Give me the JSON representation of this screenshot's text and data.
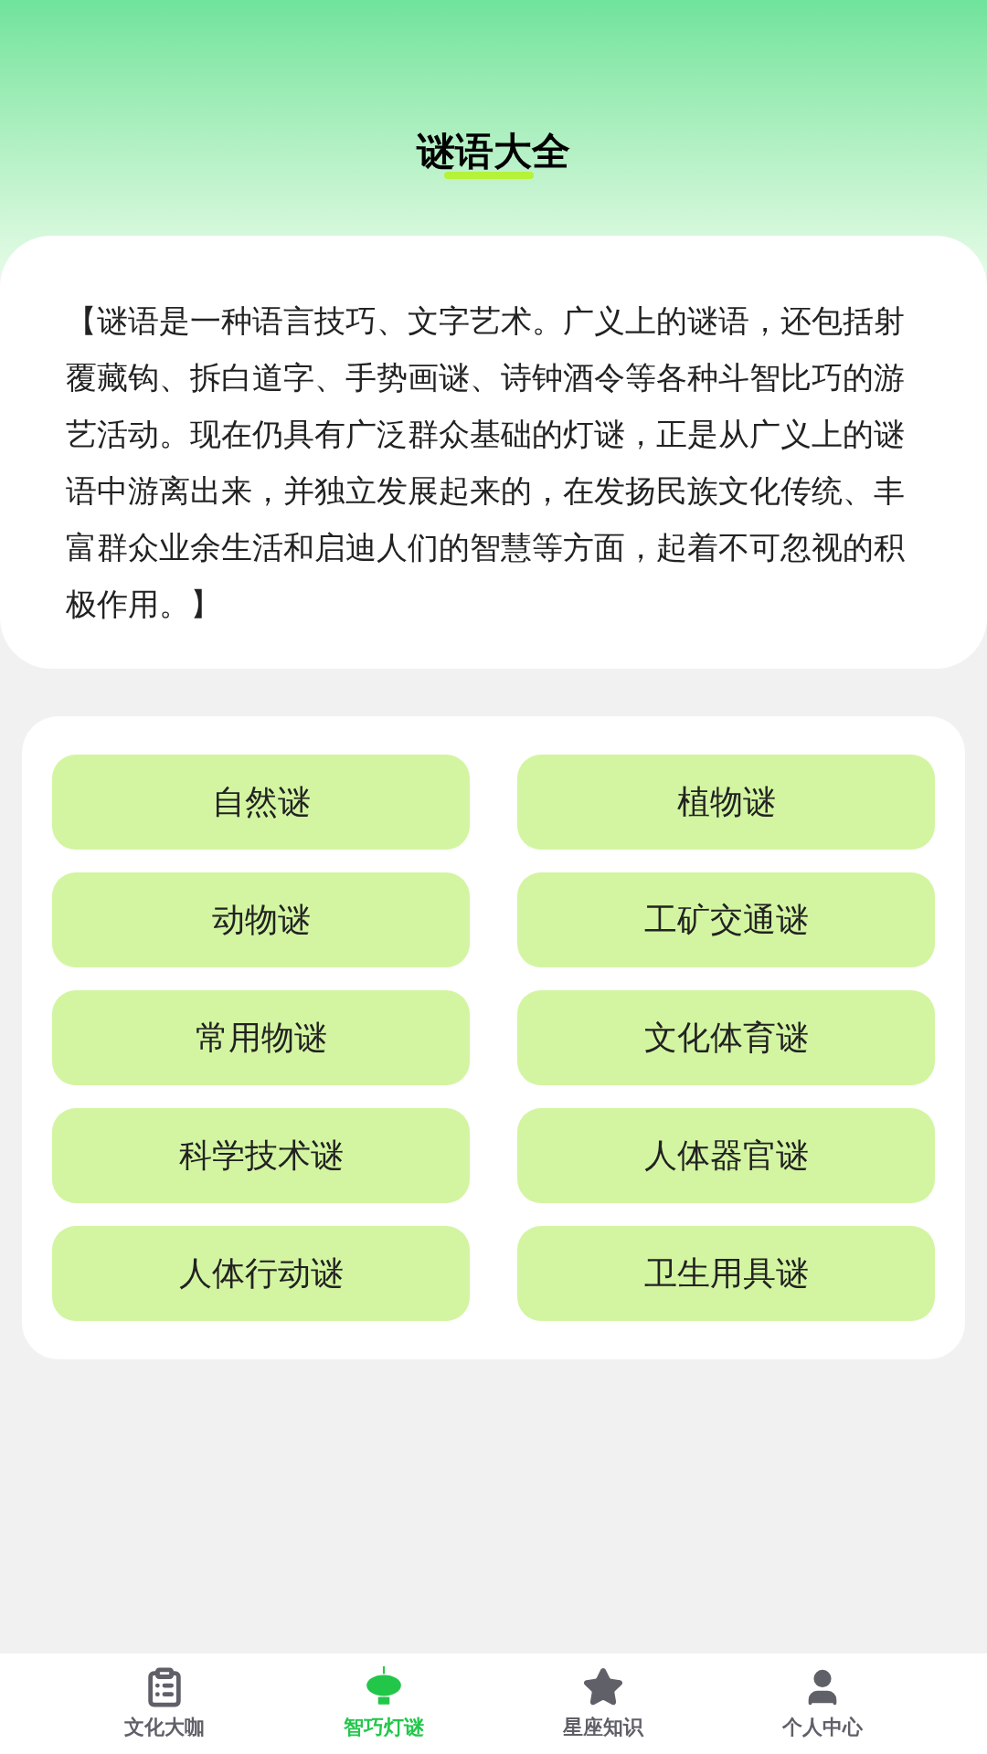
{
  "header": {
    "title": "谜语大全"
  },
  "intro": {
    "text": "【谜语是一种语言技巧、文字艺术。广义上的谜语，还包括射覆藏钩、拆白道字、手势画谜、诗钟酒令等各种斗智比巧的游艺活动。现在仍具有广泛群众基础的灯谜，正是从广义上的谜语中游离出来，并独立发展起来的，在发扬民族文化传统、丰富群众业余生活和启迪人们的智慧等方面，起着不可忽视的积极作用。】"
  },
  "categories": [
    "自然谜",
    "植物谜",
    "动物谜",
    "工矿交通谜",
    "常用物谜",
    "文化体育谜",
    "科学技术谜",
    "人体器官谜",
    "人体行动谜",
    "卫生用具谜"
  ],
  "tab_bar": [
    {
      "label": "文化大咖",
      "selected": false
    },
    {
      "label": "智巧灯谜",
      "selected": true
    },
    {
      "label": "星座知识",
      "selected": false
    },
    {
      "label": "个人中心",
      "selected": false
    }
  ]
}
